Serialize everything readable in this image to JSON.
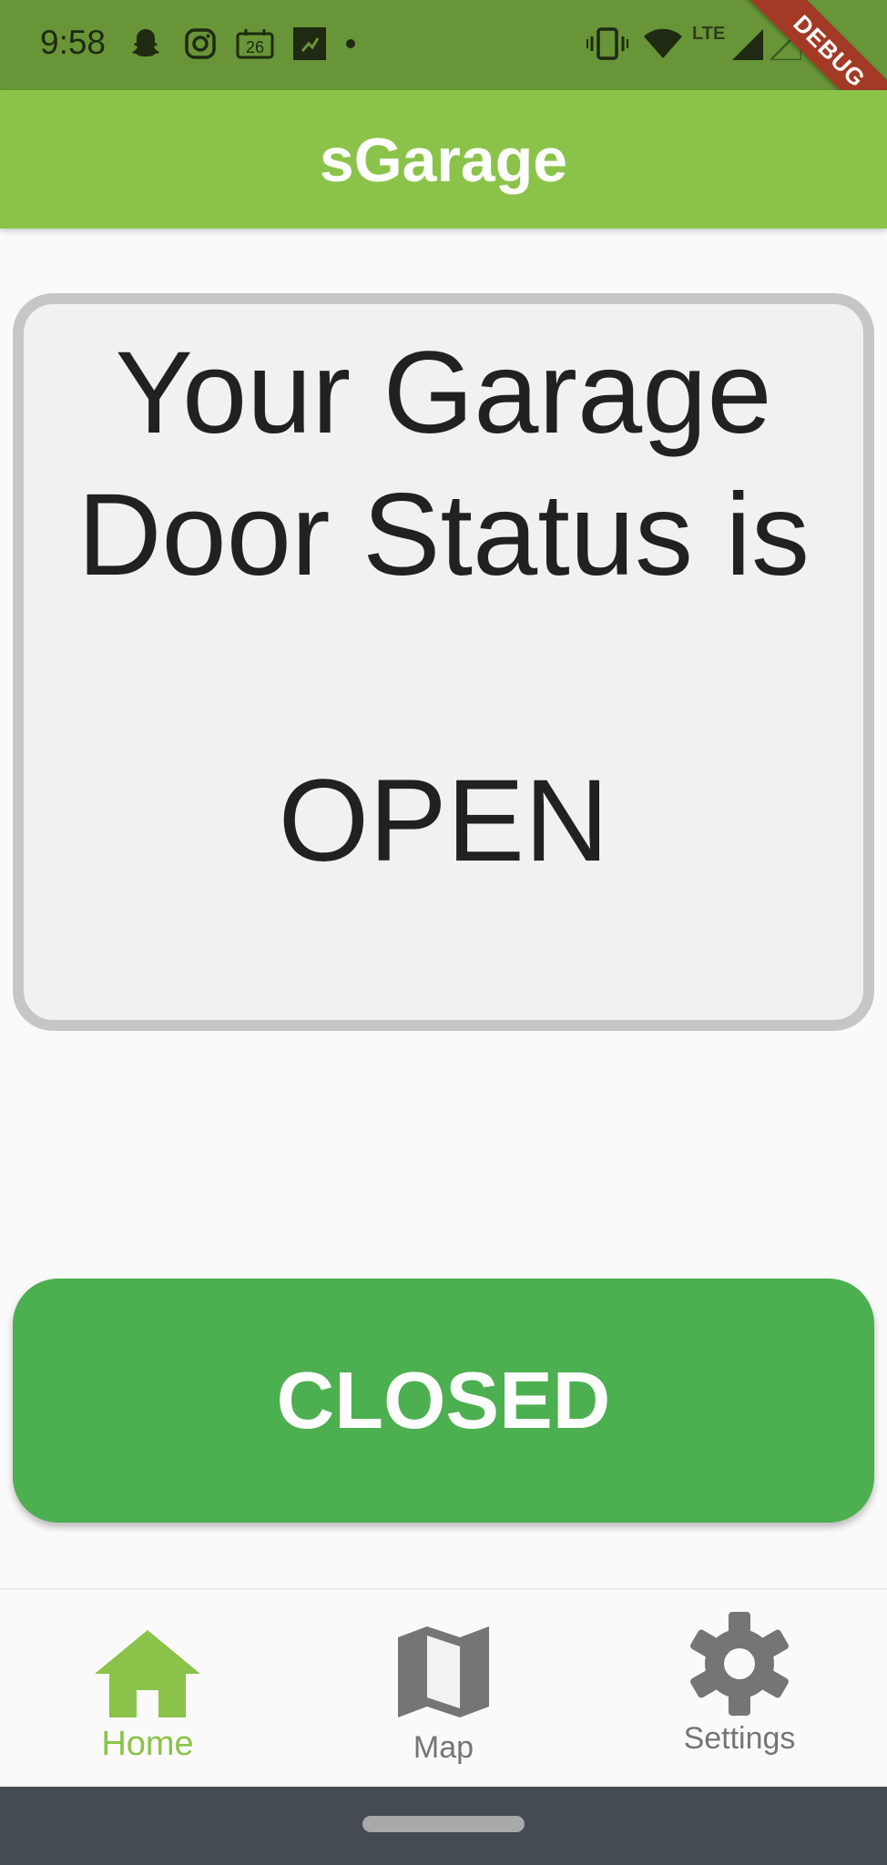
{
  "status_bar": {
    "time": "9:58",
    "notification_icons": [
      "snapchat-icon",
      "instagram-icon",
      "calendar-icon",
      "app-icon",
      "dot-icon"
    ],
    "calendar_day": "26",
    "system_icons": [
      "vibrate-icon",
      "wifi-icon",
      "lte-signal-icon",
      "signal-icon",
      "battery-icon"
    ],
    "network_label": "LTE"
  },
  "debug_banner": "DEBUG",
  "app_bar": {
    "title": "sGarage"
  },
  "status_card": {
    "heading": "Your Garage\nDoor Status is",
    "value": "OPEN"
  },
  "action_button": {
    "label": "CLOSED"
  },
  "bottom_nav": {
    "items": [
      {
        "label": "Home",
        "icon": "home-icon",
        "active": true
      },
      {
        "label": "Map",
        "icon": "map-icon",
        "active": false
      },
      {
        "label": "Settings",
        "icon": "settings-icon",
        "active": false
      }
    ]
  },
  "colors": {
    "primary": "#8bc34a",
    "status_bar": "#689537",
    "button": "#4caf50",
    "card_border": "#c6c6c6",
    "inactive_nav": "#757575"
  }
}
